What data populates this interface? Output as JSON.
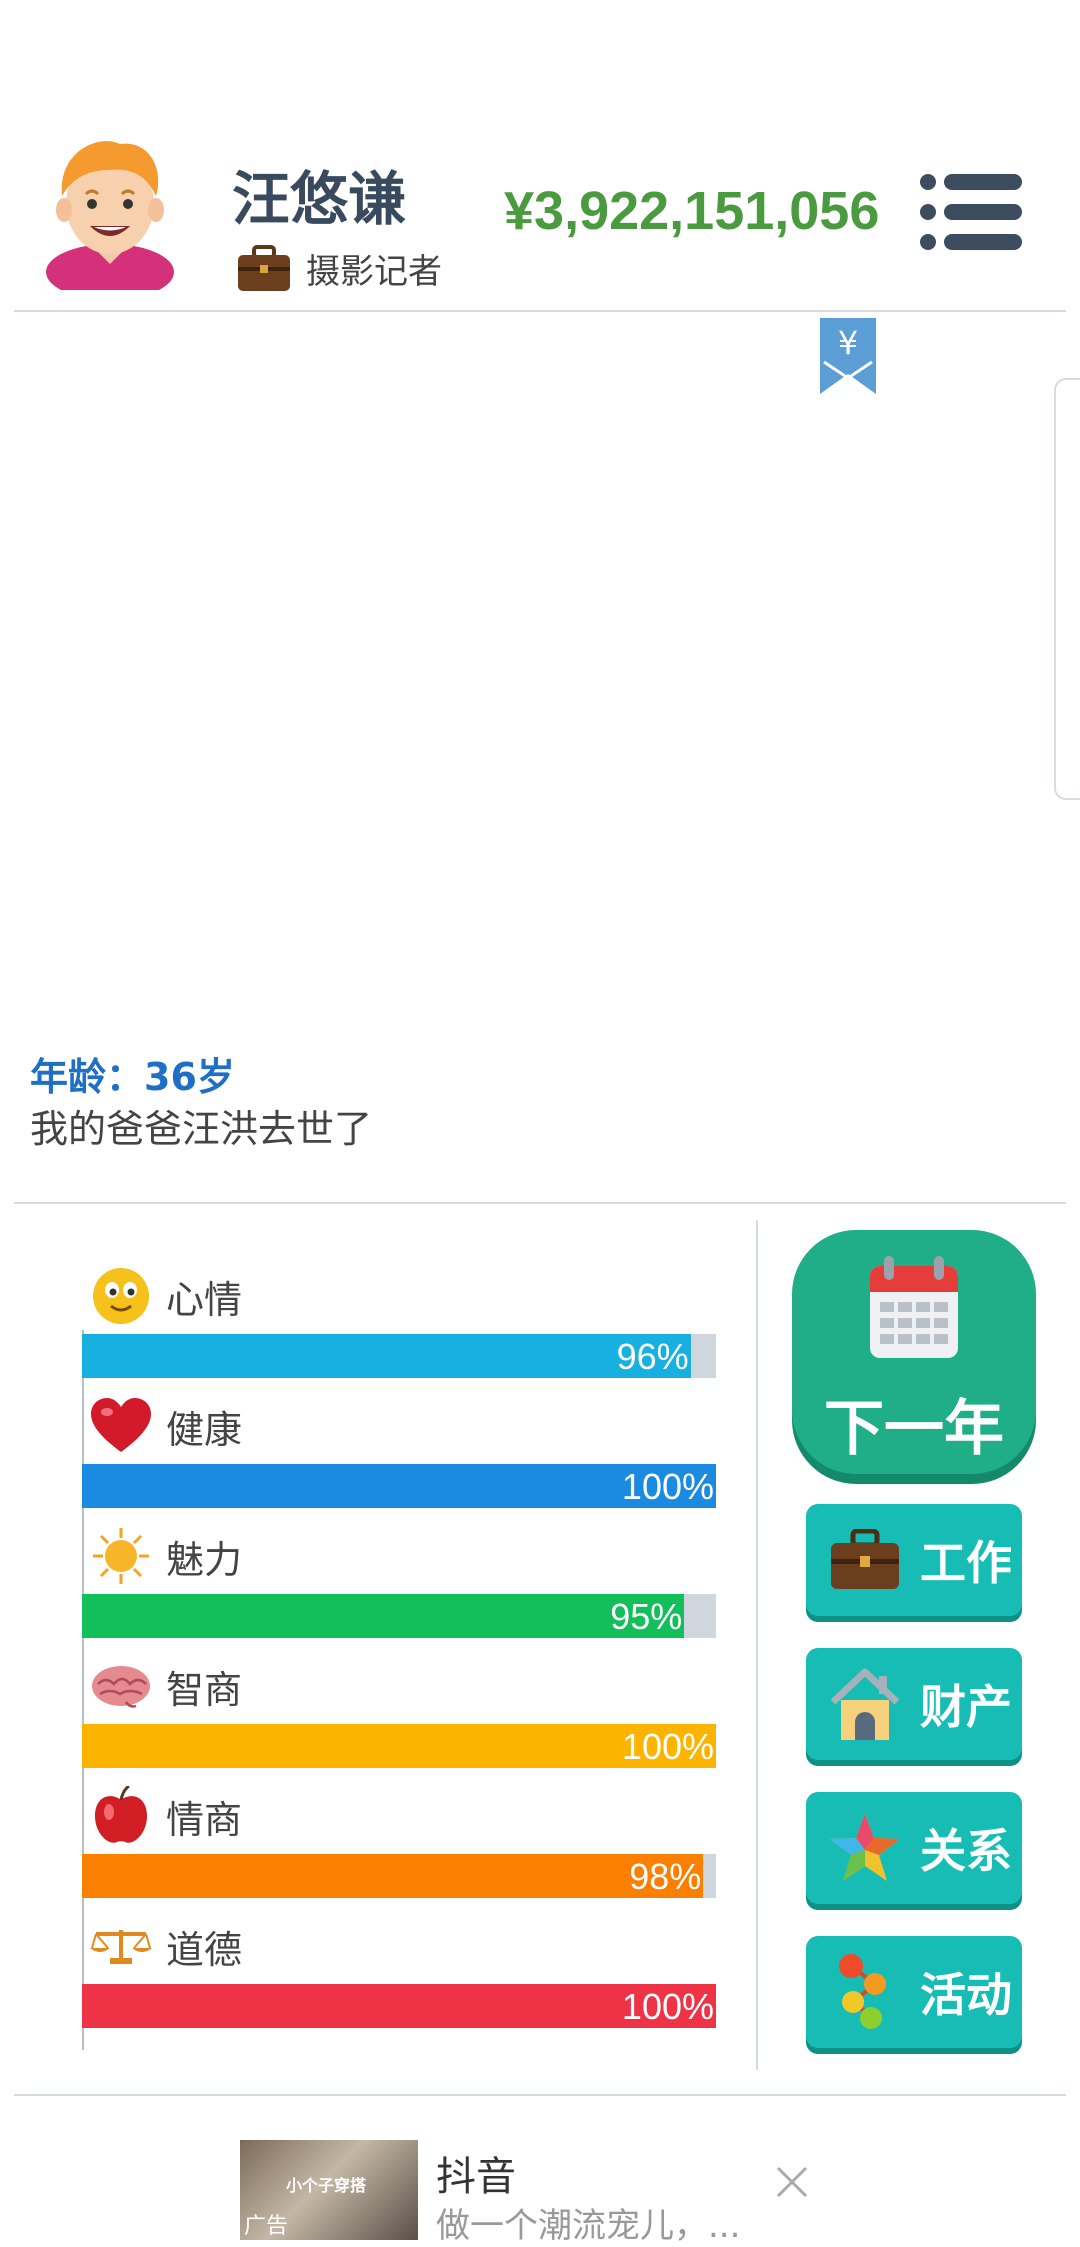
{
  "header": {
    "name": "汪悠谦",
    "job": "摄影记者",
    "money": "¥3,922,151,056"
  },
  "bookmark": {
    "symbol": "¥"
  },
  "log": {
    "age": "年龄：36岁",
    "event": "我的爸爸汪洪去世了"
  },
  "stats": [
    {
      "label": "心情",
      "percent": 96,
      "percent_text": "96%",
      "color": "#17b0e0",
      "icon": "smiley-icon"
    },
    {
      "label": "健康",
      "percent": 100,
      "percent_text": "100%",
      "color": "#1a8be0",
      "icon": "heart-icon"
    },
    {
      "label": "魅力",
      "percent": 95,
      "percent_text": "95%",
      "color": "#12bf5a",
      "icon": "sun-icon"
    },
    {
      "label": "智商",
      "percent": 100,
      "percent_text": "100%",
      "color": "#fdb400",
      "icon": "brain-icon"
    },
    {
      "label": "情商",
      "percent": 98,
      "percent_text": "98%",
      "color": "#fb7f00",
      "icon": "apple-icon"
    },
    {
      "label": "道德",
      "percent": 100,
      "percent_text": "100%",
      "color": "#ef3346",
      "icon": "scales-icon"
    }
  ],
  "actions": {
    "next_year": "下一年",
    "work": "工作",
    "property": "财产",
    "relations": "关系",
    "activities": "活动"
  },
  "ad": {
    "title": "抖音",
    "desc": "做一个潮流宠儿，...",
    "thumb_text": "小个子穿搭",
    "tag": "广告"
  },
  "colors": {
    "money": "#4a9a3f",
    "age": "#1e6fc5",
    "next_year_bg": "#1fae88",
    "action_bg": "#17bdb5"
  }
}
